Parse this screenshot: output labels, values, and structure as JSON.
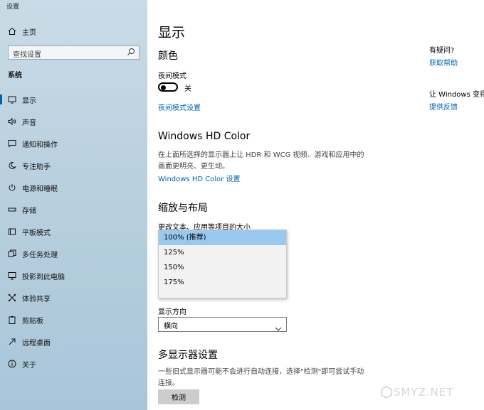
{
  "window": {
    "title": "设置"
  },
  "sidebar": {
    "home_label": "主页",
    "search": {
      "placeholder": "查找设置"
    },
    "section": "系统",
    "items": [
      {
        "label": "显示",
        "icon": "monitor-icon",
        "active": true
      },
      {
        "label": "声音",
        "icon": "speaker-icon"
      },
      {
        "label": "通知和操作",
        "icon": "message-icon"
      },
      {
        "label": "专注助手",
        "icon": "moon-icon"
      },
      {
        "label": "电源和睡眠",
        "icon": "power-icon"
      },
      {
        "label": "存储",
        "icon": "drive-icon"
      },
      {
        "label": "平板模式",
        "icon": "tablet-icon"
      },
      {
        "label": "多任务处理",
        "icon": "multitask-icon"
      },
      {
        "label": "投影到此电脑",
        "icon": "project-icon"
      },
      {
        "label": "体验共享",
        "icon": "share-icon"
      },
      {
        "label": "剪贴板",
        "icon": "clipboard-icon"
      },
      {
        "label": "远程桌面",
        "icon": "remote-icon"
      },
      {
        "label": "关于",
        "icon": "info-icon"
      }
    ]
  },
  "main": {
    "title": "显示",
    "color": {
      "heading": "颜色",
      "night_mode_label": "夜间模式",
      "night_mode_state": "关",
      "night_mode_link": "夜间模式设置"
    },
    "hdr": {
      "heading": "Windows HD Color",
      "description": "在上面所选择的显示器上让 HDR 和 WCG 视频、游戏和应用中的画面更明亮、更生动。",
      "link": "Windows HD Color 设置"
    },
    "scale": {
      "heading": "缩放与布局",
      "label": "更改文本、应用等项目的大小",
      "options": [
        "100% (推荐)",
        "125%",
        "150%",
        "175%"
      ],
      "selected_index": 0
    },
    "orientation": {
      "label": "显示方向",
      "value": "横向"
    },
    "multi": {
      "heading": "多显示器设置",
      "description": "一些旧式显示器可能不会进行自动连接，选择\"检测\"即可尝试手动连接。",
      "detect_button": "检测"
    }
  },
  "right": {
    "question": "有疑问?",
    "help_link": "获取帮助",
    "improve": "让 Windows 变得更好",
    "feedback_link": "提供反馈"
  },
  "watermark": "SMYZ.NET",
  "colors": {
    "accent": "#0063b1",
    "selection": "#99c9ef",
    "sidebar_bg": "#b9d0df"
  }
}
